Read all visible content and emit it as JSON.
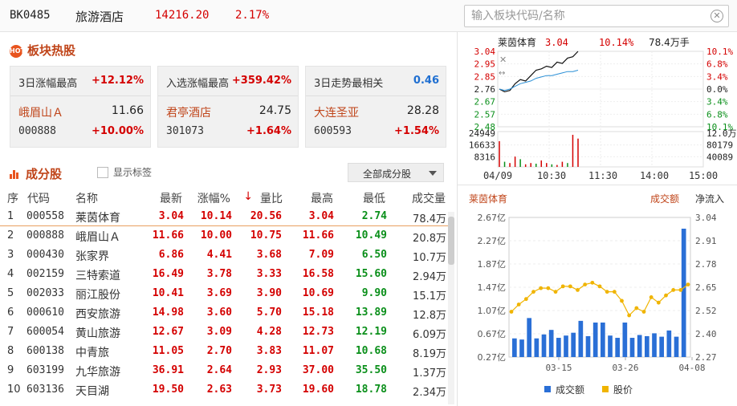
{
  "header": {
    "code": "BK0485",
    "name": "旅游酒店",
    "price": "14216.20",
    "pct": "2.17%"
  },
  "search": {
    "placeholder": "输入板块代码/名称",
    "clear_symbol": "✕"
  },
  "hot_section": {
    "icon_text": "HOT",
    "title": "板块热股"
  },
  "cards": [
    {
      "label": "3日涨幅最高",
      "label_value": "+12.12%",
      "stock_name": "峨眉山Ａ",
      "stock_price": "11.66",
      "stock_code": "000888",
      "stock_pct": "+10.00%"
    },
    {
      "label": "入选涨幅最高",
      "label_value": "+359.42%",
      "stock_name": "君亭酒店",
      "stock_price": "24.75",
      "stock_code": "301073",
      "stock_pct": "+1.64%"
    },
    {
      "label": "3日走势最相关",
      "label_value": "0.46",
      "stock_name": "大连圣亚",
      "stock_price": "28.28",
      "stock_code": "600593",
      "stock_pct": "+1.54%"
    }
  ],
  "components": {
    "title": "成分股",
    "show_tags_label": "显示标签",
    "dropdown_label": "全部成分股"
  },
  "table": {
    "columns": [
      "序",
      "代码",
      "名称",
      "最新",
      "涨幅%",
      "量比",
      "最高",
      "最低",
      "成交量"
    ],
    "sort_arrow": "↓",
    "rows": [
      {
        "seq": "1",
        "code": "000558",
        "name": "莱茵体育",
        "last": "3.04",
        "pct": "10.14",
        "vr": "20.56",
        "high": "3.04",
        "low": "2.74",
        "vol": "78.4万"
      },
      {
        "seq": "2",
        "code": "000888",
        "name": "峨眉山Ａ",
        "last": "11.66",
        "pct": "10.00",
        "vr": "10.75",
        "high": "11.66",
        "low": "10.49",
        "vol": "20.8万"
      },
      {
        "seq": "3",
        "code": "000430",
        "name": "张家界",
        "last": "6.86",
        "pct": "4.41",
        "vr": "3.68",
        "high": "7.09",
        "low": "6.50",
        "vol": "10.7万"
      },
      {
        "seq": "4",
        "code": "002159",
        "name": "三特索道",
        "last": "16.49",
        "pct": "3.78",
        "vr": "3.33",
        "high": "16.58",
        "low": "15.60",
        "vol": "2.94万"
      },
      {
        "seq": "5",
        "code": "002033",
        "name": "丽江股份",
        "last": "10.41",
        "pct": "3.69",
        "vr": "3.90",
        "high": "10.69",
        "low": "9.90",
        "vol": "15.1万"
      },
      {
        "seq": "6",
        "code": "000610",
        "name": "西安旅游",
        "last": "14.98",
        "pct": "3.60",
        "vr": "5.70",
        "high": "15.18",
        "low": "13.89",
        "vol": "12.8万"
      },
      {
        "seq": "7",
        "code": "600054",
        "name": "黄山旅游",
        "last": "12.67",
        "pct": "3.09",
        "vr": "4.28",
        "high": "12.73",
        "low": "12.19",
        "vol": "6.09万"
      },
      {
        "seq": "8",
        "code": "600138",
        "name": "中青旅",
        "last": "11.05",
        "pct": "2.70",
        "vr": "3.83",
        "high": "11.07",
        "low": "10.68",
        "vol": "8.19万"
      },
      {
        "seq": "9",
        "code": "603199",
        "name": "九华旅游",
        "last": "36.91",
        "pct": "2.64",
        "vr": "2.93",
        "high": "37.00",
        "low": "35.50",
        "vol": "1.37万"
      },
      {
        "seq": "10",
        "code": "603136",
        "name": "天目湖",
        "last": "19.50",
        "pct": "2.63",
        "vr": "3.73",
        "high": "19.60",
        "low": "18.78",
        "vol": "2.34万"
      }
    ]
  },
  "colors": {
    "up": "#d40000",
    "down": "#0a8f1a",
    "accent": "#c0451a",
    "bar": "#2a6fd6",
    "line": "#f0b400"
  },
  "chart_data": [
    {
      "type": "line",
      "title": "莱茵体育",
      "header_price": "3.04",
      "header_pct": "10.14%",
      "header_volume": "78.4万手",
      "y_ticks_left": [
        "3.04",
        "2.95",
        "2.85",
        "2.76",
        "2.67",
        "2.57",
        "2.48"
      ],
      "y_ticks_right": [
        "10.1%",
        "6.8%",
        "3.4%",
        "0.0%",
        "3.4%",
        "6.8%",
        "10.1%"
      ],
      "ylim": [
        2.48,
        3.04
      ],
      "x_ticks": [
        "04/09",
        "10:30",
        "11:30",
        "14:00",
        "15:00"
      ],
      "price": [
        2.76,
        2.74,
        2.75,
        2.8,
        2.83,
        2.82,
        2.86,
        2.9,
        2.91,
        2.93,
        2.92,
        2.96,
        2.95,
        2.99,
        3.0,
        3.04
      ],
      "avg": [
        2.76,
        2.75,
        2.76,
        2.78,
        2.8,
        2.81,
        2.82,
        2.84,
        2.85,
        2.86,
        2.86,
        2.87,
        2.88,
        2.89,
        2.89,
        2.9
      ],
      "volume_ticks_left": [
        "24949",
        "16633",
        "8316"
      ],
      "volume_ticks_right": [
        "12.0万",
        "80179",
        "40089"
      ],
      "volume": [
        20000,
        4000,
        3000,
        8000,
        6000,
        2000,
        3000,
        2500,
        5000,
        3000,
        2000,
        1500,
        4000,
        3000,
        24949,
        22000
      ]
    },
    {
      "type": "bar",
      "title": "莱茵体育",
      "tabs": [
        "成交额",
        "净流入"
      ],
      "y_ticks_left": [
        "2.67亿",
        "2.27亿",
        "1.87亿",
        "1.47亿",
        "1.07亿",
        "0.67亿",
        "0.27亿"
      ],
      "y_ticks_right": [
        "3.04",
        "2.91",
        "2.78",
        "2.65",
        "2.52",
        "2.40",
        "2.27"
      ],
      "x_ticks": [
        "03-15",
        "03-26",
        "04-08"
      ],
      "legend": [
        "成交额",
        "股价"
      ],
      "turnover": [
        0.33,
        0.31,
        0.69,
        0.33,
        0.4,
        0.48,
        0.34,
        0.38,
        0.43,
        0.64,
        0.37,
        0.61,
        0.61,
        0.38,
        0.34,
        0.61,
        0.34,
        0.39,
        0.37,
        0.42,
        0.36,
        0.47,
        0.36,
        2.27
      ],
      "price": [
        2.52,
        2.56,
        2.59,
        2.63,
        2.65,
        2.65,
        2.63,
        2.66,
        2.66,
        2.64,
        2.67,
        2.68,
        2.66,
        2.63,
        2.63,
        2.58,
        2.5,
        2.54,
        2.52,
        2.6,
        2.57,
        2.61,
        2.64,
        2.64,
        2.67
      ]
    }
  ]
}
